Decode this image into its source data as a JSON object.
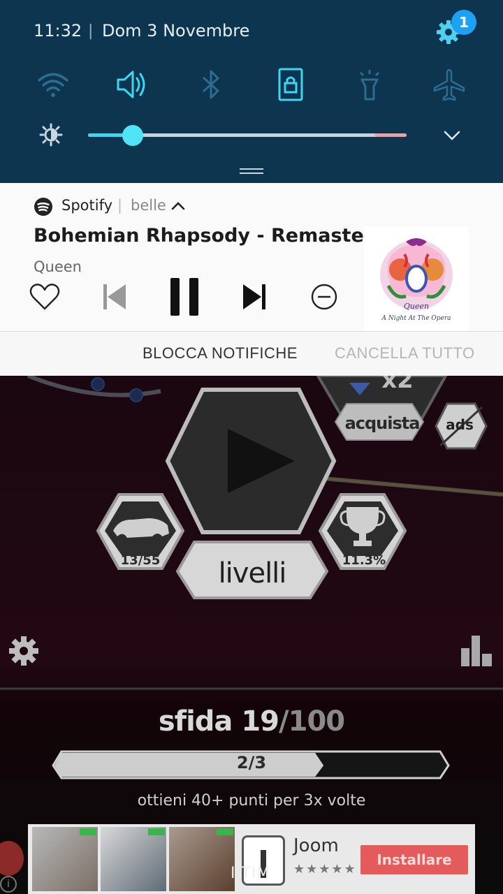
{
  "status_bar": {
    "time": "11:32",
    "separator": "|",
    "date": "Dom 3 Novembre",
    "notification_count": "1"
  },
  "quick_toggles": [
    {
      "name": "wifi",
      "icon": "wifi-icon",
      "active": false
    },
    {
      "name": "sound",
      "icon": "volume-icon",
      "active": true
    },
    {
      "name": "bluetooth",
      "icon": "bluetooth-icon",
      "active": false
    },
    {
      "name": "rotation-lock",
      "icon": "lock-icon",
      "active": true
    },
    {
      "name": "flashlight",
      "icon": "flashlight-icon",
      "active": false
    },
    {
      "name": "airplane",
      "icon": "airplane-icon",
      "active": false
    }
  ],
  "brightness": {
    "level": 0.14
  },
  "notification": {
    "app_name": "Spotify",
    "separator": "|",
    "subtext": "belle",
    "song_title": "Bohemian Rhapsody - Remaste..",
    "artist": "Queen",
    "album_art_caption_1": "Queen",
    "album_art_caption_2": "A Night At The Opera"
  },
  "notification_actions": {
    "block": "BLOCCA NOTIFICHE",
    "clear_all": "CANCELLA TUTTO"
  },
  "game": {
    "x2": "x2",
    "buy": "acquista",
    "ads": "ads",
    "levels_count": "13/55",
    "levels_label": "livelli",
    "percent": "11.3%",
    "challenge_label": "sfida",
    "challenge_current": "19",
    "challenge_total": "/100",
    "progress_text": "2/3",
    "progress_value": 0.67,
    "goal_text": "ottieni 40+ punti per 3x volte"
  },
  "ad": {
    "app_name": "Joom",
    "stars": "★★★★★",
    "install_label": "Installare",
    "carrier": "I TIM",
    "info": "i"
  },
  "colors": {
    "panel": "#0e3550",
    "accent": "#3fd6f0",
    "badge": "#1da1f2",
    "install": "#e35b5b"
  }
}
